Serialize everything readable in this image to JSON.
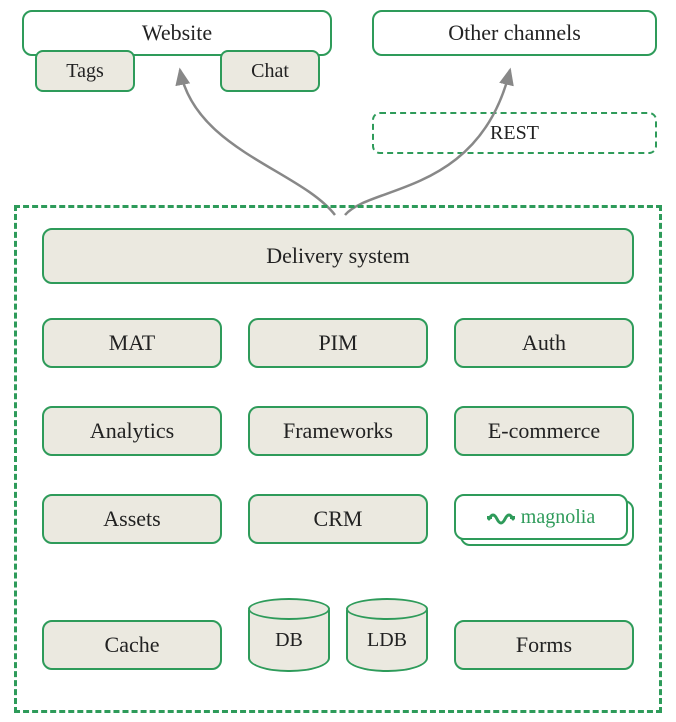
{
  "top": {
    "website": "Website",
    "other_channels": "Other channels",
    "tags": "Tags",
    "chat": "Chat",
    "rest": "REST"
  },
  "system": {
    "delivery": "Delivery system",
    "row1": {
      "mat": "MAT",
      "pim": "PIM",
      "auth": "Auth"
    },
    "row2": {
      "analytics": "Analytics",
      "frameworks": "Frameworks",
      "ecommerce": "E-commerce"
    },
    "row3": {
      "assets": "Assets",
      "crm": "CRM",
      "magnolia": "magnolia"
    },
    "row4": {
      "cache": "Cache",
      "db": "DB",
      "ldb": "LDB",
      "forms": "Forms"
    }
  },
  "colors": {
    "border": "#2e9b5a",
    "fill": "#ebe9e0",
    "arrow": "#888888"
  }
}
